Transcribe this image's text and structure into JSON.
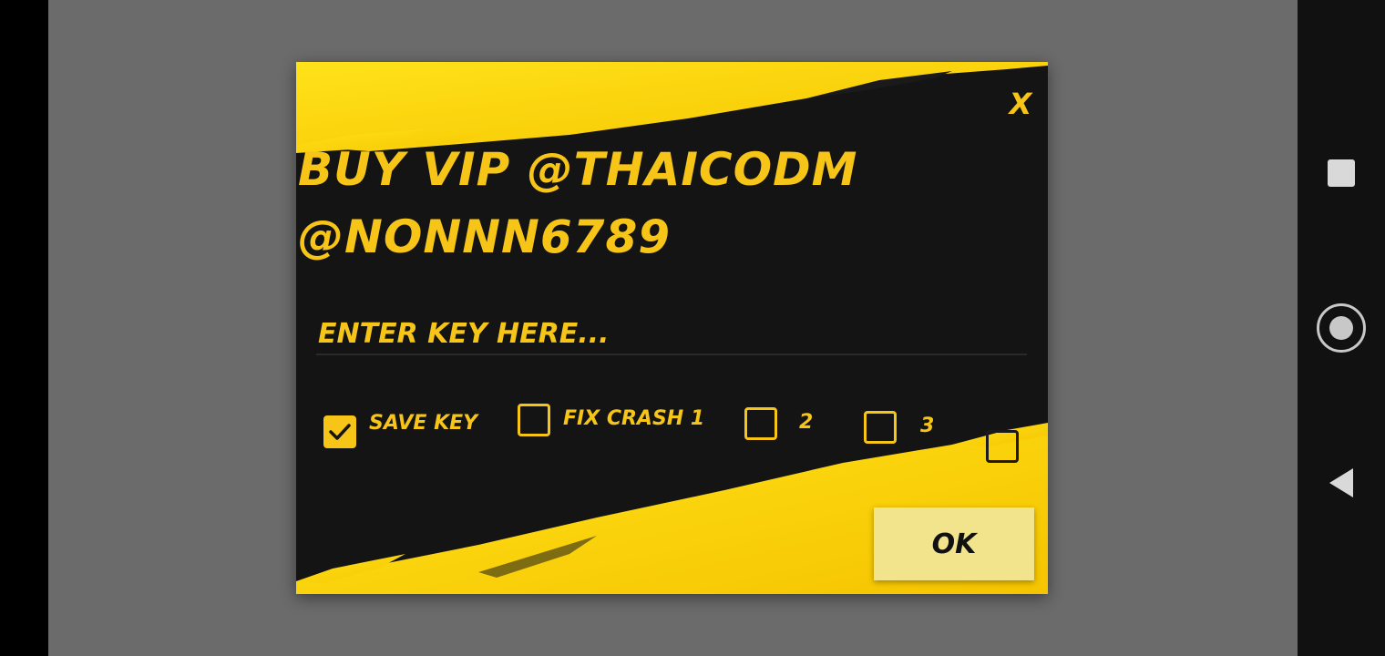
{
  "dialog": {
    "title_line1": "BUY VIP @THAICODM",
    "title_line2": "@NONNN6789",
    "close_label": "X",
    "key_placeholder": "ENTER KEY HERE...",
    "key_value": "",
    "ok_label": "OK",
    "options": [
      {
        "label": "SAVE KEY",
        "checked": true
      },
      {
        "label": "FIX CRASH 1",
        "checked": false
      },
      {
        "label": "2",
        "checked": false
      },
      {
        "label": "3",
        "checked": false
      },
      {
        "label": "",
        "checked": false
      }
    ],
    "colors": {
      "accent": "#f6c518",
      "background": "#141414",
      "ok_button": "#f2e48c"
    }
  },
  "nav_bar": {
    "icons": [
      "recents-square-icon",
      "home-circle-icon",
      "back-triangle-icon"
    ]
  }
}
